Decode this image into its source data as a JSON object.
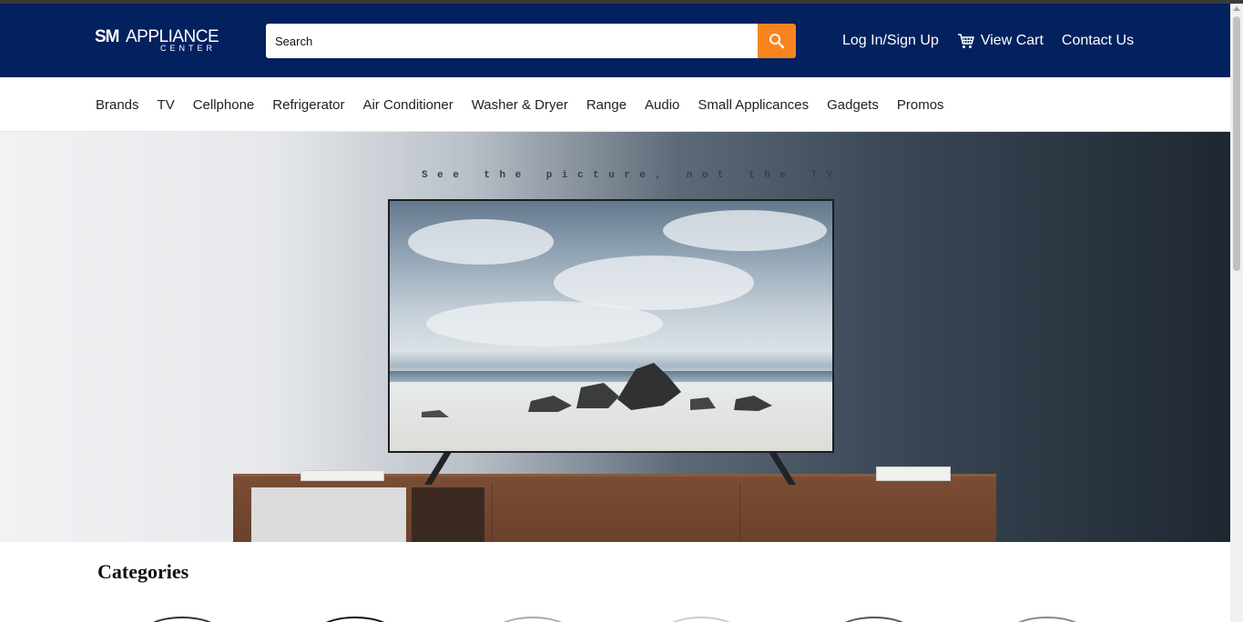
{
  "header": {
    "logo": {
      "brand": "SM",
      "name": "APPLIANCE",
      "sub": "CENTER"
    },
    "search": {
      "placeholder": "Search",
      "icon": "search-icon"
    },
    "links": {
      "login": "Log In/Sign Up",
      "cart": "View Cart",
      "cart_icon": "cart-icon",
      "contact": "Contact Us"
    },
    "colors": {
      "background": "#02215e",
      "search_button": "#f6851f"
    }
  },
  "nav": {
    "items": [
      "Brands",
      "TV",
      "Cellphone",
      "Refrigerator",
      "Air Conditioner",
      "Washer & Dryer",
      "Range",
      "Audio",
      "Small Applicances",
      "Gadgets",
      "Promos"
    ]
  },
  "hero": {
    "tagline": "See the picture, not the TV"
  },
  "categories": {
    "title": "Categories"
  }
}
